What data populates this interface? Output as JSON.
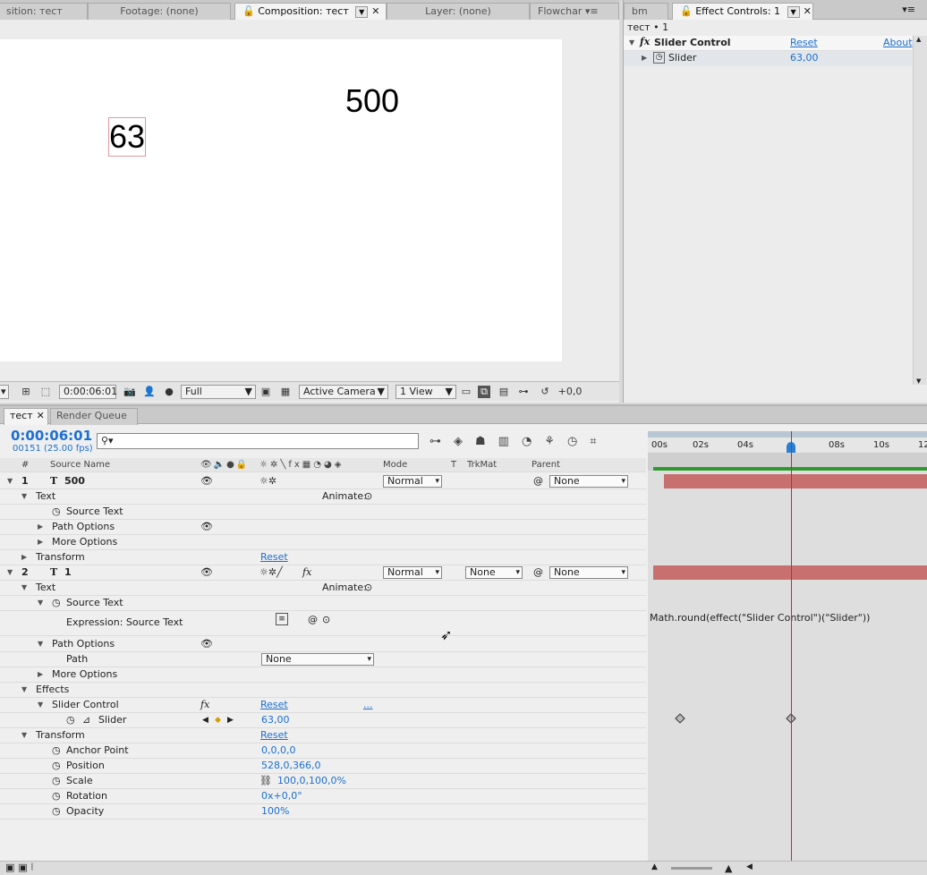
{
  "comp_panel": {
    "tabs": [
      {
        "label": "sition: тест",
        "active": false
      },
      {
        "label": "Footage: (none)",
        "active": false
      },
      {
        "label": "Composition: тест",
        "active": true
      },
      {
        "label": "Layer: (none)",
        "active": false
      },
      {
        "label": "Flowchar",
        "active": false
      }
    ],
    "canvas_texts": [
      "500",
      "63"
    ],
    "toolbar": {
      "timecode": "0:00:06:01",
      "resolution": "Full",
      "camera": "Active Camera",
      "views": "1 View",
      "exposure": "+0,0"
    }
  },
  "effect_controls": {
    "tabs": [
      {
        "label": "bm",
        "active": false
      },
      {
        "label": "Effect Controls: 1",
        "active": true
      }
    ],
    "breadcrumb": "тест • 1",
    "effect_name": "Slider Control",
    "reset_label": "Reset",
    "about_label": "About",
    "param_name": "Slider",
    "param_value": "63,00"
  },
  "timeline": {
    "tabs": [
      {
        "label": "тест",
        "active": true
      },
      {
        "label": "Render Queue",
        "active": false
      }
    ],
    "timecode": "0:00:06:01",
    "frame_info": "00151 (25.00 fps)",
    "search_placeholder": "",
    "columns": {
      "num": "#",
      "source_name": "Source Name",
      "mode": "Mode",
      "t": "T",
      "trkmat": "TrkMat",
      "parent": "Parent"
    },
    "ruler": [
      "00s",
      "02s",
      "04s",
      "08s",
      "10s",
      "12"
    ],
    "animate_label": "Animate:",
    "reset_label": "Reset",
    "ellipsis": "...",
    "mode_normal": "Normal",
    "none": "None",
    "layers": [
      {
        "num": "1",
        "name": "500"
      },
      {
        "num": "2",
        "name": "1"
      }
    ],
    "props": {
      "text": "Text",
      "source_text": "Source Text",
      "path_options": "Path Options",
      "more_options": "More Options",
      "transform": "Transform",
      "expression": "Expression: Source Text",
      "path": "Path",
      "effects": "Effects",
      "slider_control": "Slider Control",
      "slider": "Slider",
      "anchor_point": "Anchor Point",
      "position": "Position",
      "scale": "Scale",
      "rotation": "Rotation",
      "opacity": "Opacity"
    },
    "values": {
      "slider": "63,00",
      "anchor_point": "0,0,0,0",
      "position": "528,0,366,0",
      "scale": "100,0,100,0%",
      "rotation": "0x+0,0°",
      "opacity": "100%"
    },
    "expression_text": "Math.round(effect(\"Slider Control\")(\"Slider\"))",
    "colors": {
      "accent": "#1c6fd1",
      "layer_bar": "#c87070",
      "work_area": "#2e9a2e",
      "cti": "#e02020"
    }
  }
}
